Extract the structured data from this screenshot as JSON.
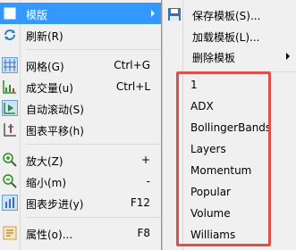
{
  "main_menu": {
    "items": [
      {
        "label": "模版",
        "shortcut": "",
        "icon": "template-icon"
      },
      {
        "label": "刷新(R)",
        "shortcut": "",
        "icon": "refresh-icon"
      },
      {
        "label": "网格(G)",
        "shortcut": "Ctrl+G",
        "icon": "grid-icon"
      },
      {
        "label": "成交量(u)",
        "shortcut": "Ctrl+L",
        "icon": "volume-icon"
      },
      {
        "label": "自动滚动(S)",
        "shortcut": "",
        "icon": "autoscroll-icon"
      },
      {
        "label": "图表平移(h)",
        "shortcut": "",
        "icon": "chart-shift-icon"
      },
      {
        "label": "放大(Z)",
        "shortcut": "+",
        "icon": "zoom-in-icon"
      },
      {
        "label": "缩小(m)",
        "shortcut": "-",
        "icon": "zoom-out-icon"
      },
      {
        "label": "图表步进(y)",
        "shortcut": "F12",
        "icon": "step-icon"
      },
      {
        "label": "属性(o)...",
        "shortcut": "F8",
        "icon": "properties-icon"
      }
    ]
  },
  "submenu": {
    "items": [
      {
        "label": "保存模板(S)...",
        "icon": "save-template-icon"
      },
      {
        "label": "加载模板(L)...",
        "icon": ""
      },
      {
        "label": "删除模板",
        "icon": ""
      }
    ],
    "templates": [
      "1",
      "ADX",
      "BollingerBands",
      "Layers",
      "Momentum",
      "Popular",
      "Volume",
      "Williams"
    ]
  },
  "colors": {
    "menu_bg": "#f0f0f0",
    "highlight": "#3399ff",
    "hover": "#cce8ff",
    "annotation_box": "#e0504b"
  }
}
